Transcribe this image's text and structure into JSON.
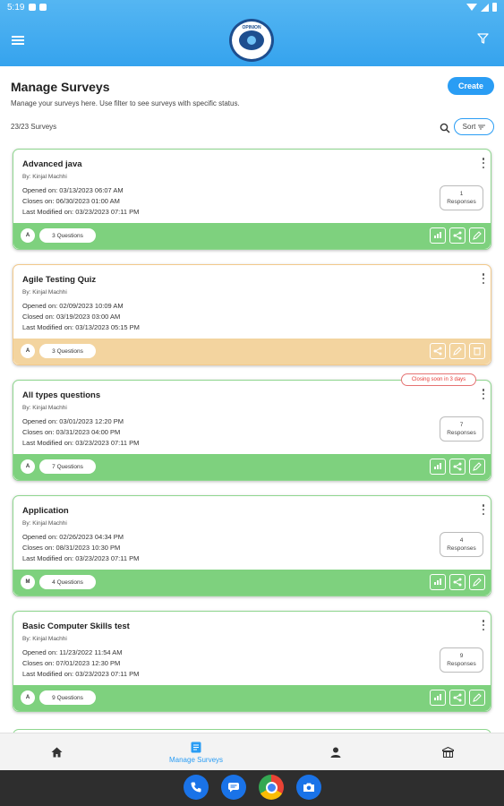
{
  "status_bar": {
    "time": "5:19"
  },
  "header": {
    "logo_text": "OPINION"
  },
  "page": {
    "title": "Manage Surveys",
    "create_label": "Create",
    "subtitle": "Manage your surveys here. Use filter to see surveys with specific status.",
    "count": "23/23 Surveys",
    "sort_label": "Sort"
  },
  "surveys": [
    {
      "title": "Advanced java",
      "author": "By: Kinjal Machhi",
      "line1": "Opened on: 03/13/2023 06:07 AM",
      "line2": "Closes on: 06/30/2023 01:00 AM",
      "line3": "Last Modified on: 03/23/2023 07:11 PM",
      "responses_count": "1",
      "responses_label": "Responses",
      "type_letter": "A",
      "questions": "3 Questions",
      "status": "active",
      "status_color": "#7ed17e",
      "badge": ""
    },
    {
      "title": "Agile Testing Quiz",
      "author": "By: Kinjal Machhi",
      "line1": "Opened on: 02/09/2023 10:09 AM",
      "line2": "Closed on: 03/19/2023 03:00 AM",
      "line3": "Last Modified on: 03/13/2023 05:15 PM",
      "responses_count": "",
      "responses_label": "",
      "type_letter": "A",
      "questions": "3 Questions",
      "status": "closed",
      "status_color": "#f3d49f",
      "badge": ""
    },
    {
      "title": "All types questions",
      "author": "By: Kinjal Machhi",
      "line1": "Opened on: 03/01/2023 12:20 PM",
      "line2": "Closes on: 03/31/2023 04:00 PM",
      "line3": "Last Modified on: 03/23/2023 07:11 PM",
      "responses_count": "7",
      "responses_label": "Responses",
      "type_letter": "A",
      "questions": "7 Questions",
      "status": "active",
      "status_color": "#7ed17e",
      "badge": "Closing soon in 3 days"
    },
    {
      "title": "Application",
      "author": "By: Kinjal Machhi",
      "line1": "Opened on: 02/26/2023 04:34 PM",
      "line2": "Closes on: 08/31/2023 10:30 PM",
      "line3": "Last Modified on: 03/23/2023 07:11 PM",
      "responses_count": "4",
      "responses_label": "Responses",
      "type_letter": "M",
      "questions": "4 Questions",
      "status": "active",
      "status_color": "#7ed17e",
      "badge": ""
    },
    {
      "title": "Basic Computer Skills test",
      "author": "By: Kinjal Machhi",
      "line1": "Opened on: 11/23/2022 11:54 AM",
      "line2": "Closes on: 07/01/2023 12:30 PM",
      "line3": "Last Modified on: 03/23/2023 07:11 PM",
      "responses_count": "9",
      "responses_label": "Responses",
      "type_letter": "A",
      "questions": "9 Questions",
      "status": "active",
      "status_color": "#7ed17e",
      "badge": ""
    }
  ],
  "bottom_nav": {
    "items": [
      {
        "icon": "home-icon",
        "label": ""
      },
      {
        "icon": "survey-list-icon",
        "label": "Manage Surveys",
        "active": true
      },
      {
        "icon": "person-icon",
        "label": ""
      },
      {
        "icon": "building-icon",
        "label": ""
      }
    ]
  },
  "dock": [
    "phone-icon",
    "messages-icon",
    "chrome-icon",
    "camera-icon"
  ]
}
